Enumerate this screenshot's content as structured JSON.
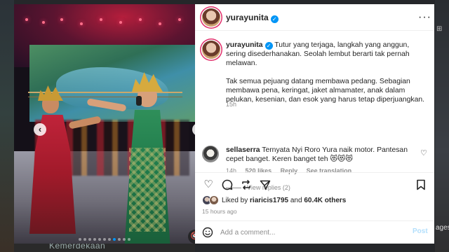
{
  "background": {
    "left_text": "Kemerdekaan",
    "right_word": "ages"
  },
  "media": {
    "prev_icon": "chevron-left-icon",
    "next_icon": "chevron-right-icon",
    "mute_icon": "speaker-muted-icon",
    "carousel_count": 11,
    "carousel_active": 8
  },
  "post": {
    "username": "yurayunita",
    "verified": true,
    "caption_paragraph_1": "Tutur yang terjaga, langkah yang anggun, sering disederhanakan. Seolah lembut berarti tak pernah melawan.",
    "caption_paragraph_2": "Tak semua pejuang datang membawa pedang. Sebagian membawa pena, keringat, jaket almamater, anak dalam pelukan, kesenian, dan esok yang harus tetap diperjuangkan.",
    "caption_time": "15h"
  },
  "comment": {
    "username": "sellaserra",
    "text": "Ternyata Nyi Roro Yura naik motor. Pantesan cepet banget. Keren banget teh 😻😻😻",
    "time": "14h",
    "likes": "520 likes",
    "reply_label": "Reply",
    "translate_label": "See translation",
    "view_replies": "View replies (2)"
  },
  "likes": {
    "prefix": "Liked by",
    "user": "riaricis1795",
    "connector": "and",
    "others": "60.4K others"
  },
  "post_age": "15 hours ago",
  "composer": {
    "placeholder": "Add a comment...",
    "post_label": "Post"
  },
  "colors": {
    "accent_blue": "#0095f6",
    "post_button_disabled": "#b2dffc",
    "muted_text": "#8e8e8e"
  }
}
